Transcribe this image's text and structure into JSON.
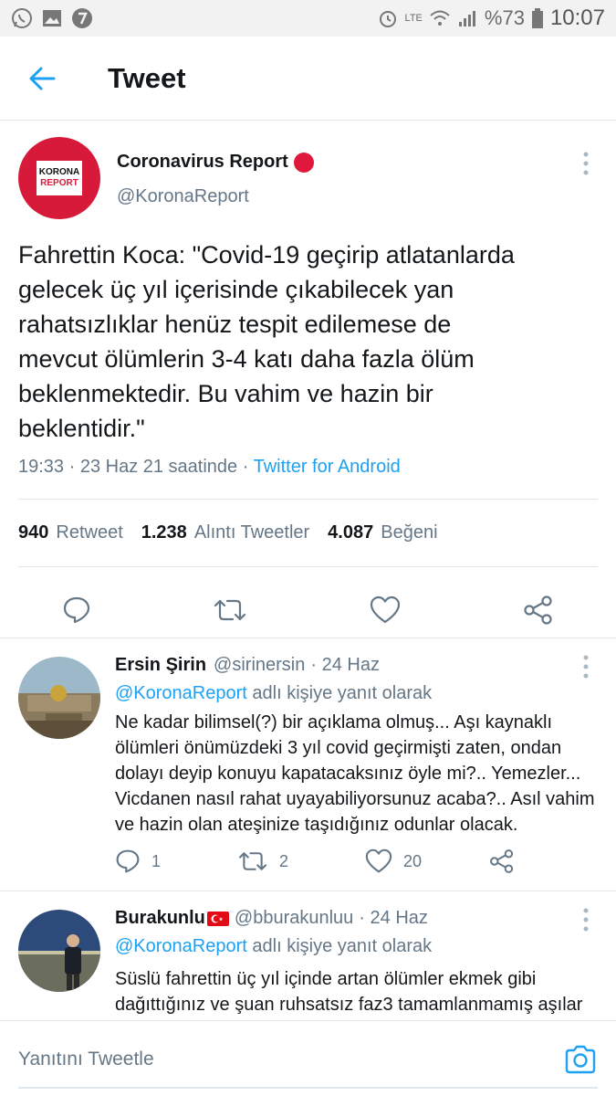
{
  "status_bar": {
    "battery": "%73",
    "network": "LTE",
    "time": "10:07"
  },
  "header": {
    "title": "Tweet"
  },
  "main_tweet": {
    "author_name": "Coronavirus Report",
    "author_handle": "@KoronaReport",
    "logo_line1": "KORONA",
    "logo_line2": "REPORT",
    "text": "Fahrettin Koca: \"Covid-19 geçirip atlatanlarda\ngelecek üç yıl içerisinde çıkabilecek yan\nrahatsızlıklar henüz tespit edilemese de\nmevcut ölümlerin 3-4 katı daha fazla ölüm\nbeklenmektedir. Bu vahim ve hazin bir\nbeklentidir.\"",
    "meta_time": "19:33 · 23 Haz 21 saatinde · ",
    "meta_source": "Twitter for Android",
    "stats": {
      "retweets": "940",
      "retweets_label": "Retweet",
      "quotes": "1.238",
      "quotes_label": "Alıntı Tweetler",
      "likes": "4.087",
      "likes_label": "Beğeni"
    }
  },
  "replies": [
    {
      "name": "Ersin Şirin",
      "handle": "@sirinersin",
      "date": "· 24 Haz",
      "reply_to_mention": "@KoronaReport",
      "reply_to_suffix": " adlı kişiye yanıt olarak",
      "text": "Ne kadar bilimsel(?) bir açıklama olmuş... Aşı kaynaklı ölümleri önümüzdeki 3 yıl covid geçirmişti zaten, ondan dolayı deyip konuyu kapatacaksınız öyle mi?.. Yemezler... Vicdanen nasıl rahat uyayabiliyorsunuz acaba?.. Asıl vahim ve hazin olan ateşinize taşıdığınız odunlar olacak.",
      "replies_count": "1",
      "retweets_count": "2",
      "likes_count": "20"
    },
    {
      "name": "Burakunlu",
      "handle": "@bburakunluu",
      "date": "· 24 Haz",
      "reply_to_mention": "@KoronaReport",
      "reply_to_suffix": " adlı kişiye yanıt olarak",
      "text": "Süslü fahrettin üç yıl içinde artan ölümler ekmek gibi dağıttığınız ve şuan ruhsatsız faz3 tamamlanmamış aşılar"
    }
  ],
  "compose": {
    "placeholder": "Yanıtını Tweetle"
  },
  "colors": {
    "accent": "#1da1f2",
    "brand_red": "#d7193a"
  }
}
